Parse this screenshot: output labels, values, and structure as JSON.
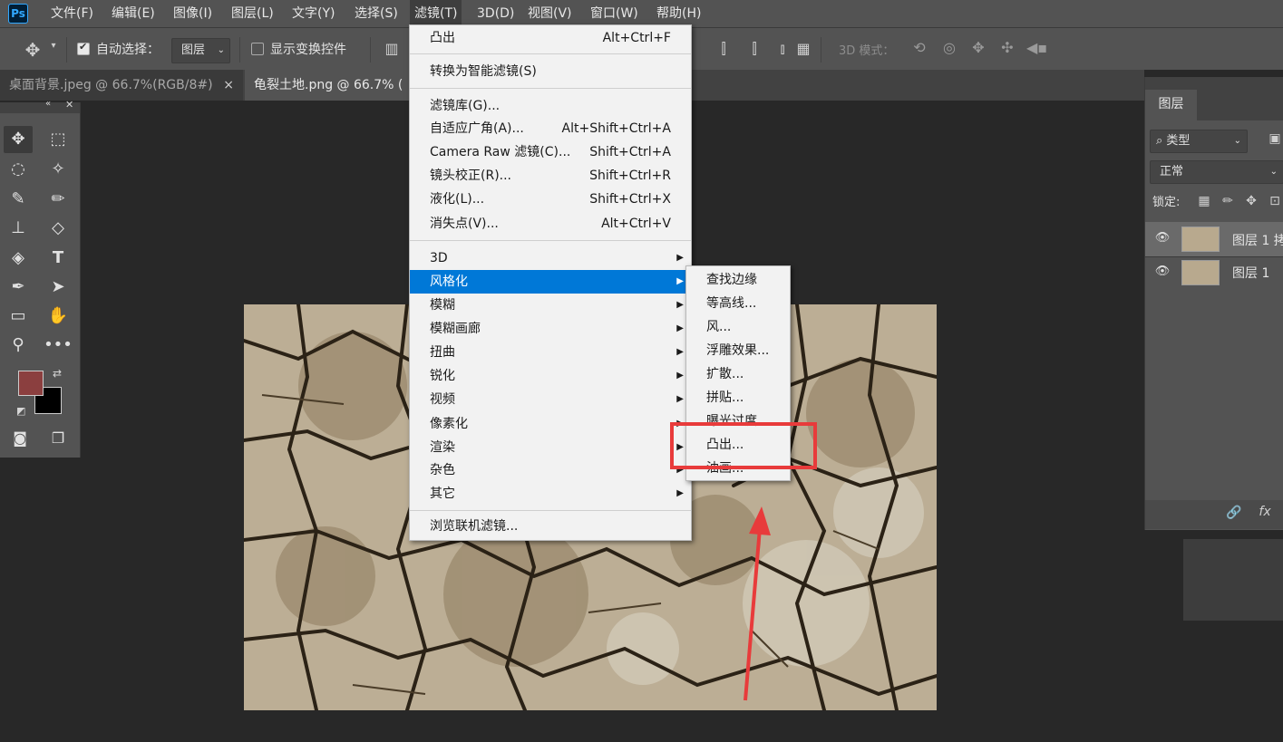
{
  "app": {
    "logo": "Ps"
  },
  "menubar": {
    "items": [
      "文件(F)",
      "编辑(E)",
      "图像(I)",
      "图层(L)",
      "文字(Y)",
      "选择(S)",
      "滤镜(T)",
      "3D(D)",
      "视图(V)",
      "窗口(W)",
      "帮助(H)"
    ],
    "active": "滤镜(T)"
  },
  "options": {
    "auto_select_label": "自动选择：",
    "auto_select_checked": true,
    "target_value": "图层",
    "show_transform_label": "显示变换控件",
    "mode_label": "3D 模式："
  },
  "tabs": [
    {
      "label": "桌面背景.jpeg @ 66.7%(RGB/8#)",
      "close": "×"
    },
    {
      "label": "龟裂土地.png @ 66.7% (",
      "close": ""
    }
  ],
  "filter_menu": {
    "last_filter": {
      "label": "凸出",
      "shortcut": "Alt+Ctrl+F"
    },
    "convert_smart": "转换为智能滤镜(S)",
    "group2": [
      {
        "label": "滤镜库(G)...",
        "shortcut": ""
      },
      {
        "label": "自适应广角(A)...",
        "shortcut": "Alt+Shift+Ctrl+A"
      },
      {
        "label": "Camera Raw 滤镜(C)...",
        "shortcut": "Shift+Ctrl+A"
      },
      {
        "label": "镜头校正(R)...",
        "shortcut": "Shift+Ctrl+R"
      },
      {
        "label": "液化(L)...",
        "shortcut": "Shift+Ctrl+X"
      },
      {
        "label": "消失点(V)...",
        "shortcut": "Alt+Ctrl+V"
      }
    ],
    "submenus": [
      "3D",
      "风格化",
      "模糊",
      "模糊画廊",
      "扭曲",
      "锐化",
      "视频",
      "像素化",
      "渲染",
      "杂色",
      "其它"
    ],
    "highlighted": "风格化",
    "browse_online": "浏览联机滤镜..."
  },
  "stylize_submenu": {
    "items": [
      "查找边缘",
      "等高线...",
      "风...",
      "浮雕效果...",
      "扩散...",
      "拼贴...",
      "曝光过度",
      "凸出...",
      "油画..."
    ],
    "annotated": "凸出..."
  },
  "layers_panel": {
    "tab": "图层",
    "filter_kind": "类型",
    "blend_mode": "正常",
    "lock_label": "锁定:",
    "layers": [
      {
        "name": "图层 1 拷",
        "visible": true,
        "selected": true
      },
      {
        "name": "图层 1",
        "visible": true,
        "selected": false
      }
    ]
  },
  "colors": {
    "foreground": "#8b3f3f",
    "background": "#000000",
    "menu_highlight": "#0078d7",
    "annotation": "#e83b3b"
  }
}
